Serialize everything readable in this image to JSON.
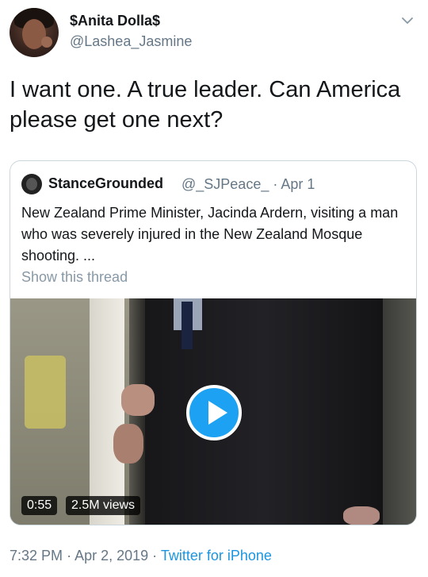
{
  "author": {
    "display_name": "$Anita Dolla$",
    "handle": "@Lashea_Jasmine"
  },
  "tweet": {
    "text": "I want one. A true leader. Can America please get one next?"
  },
  "quoted_tweet": {
    "display_name": "StanceGrounded",
    "handle": "@_SJPeace_",
    "separator": "·",
    "date": "Apr 1",
    "text": "New Zealand Prime Minister, Jacinda Ardern, visiting a man who was severely injured in the New Zealand Mosque shooting. ...",
    "show_thread": "Show this thread",
    "video": {
      "duration": "0:55",
      "views": "2.5M views"
    }
  },
  "footer": {
    "time": "7:32 PM",
    "separator": "·",
    "date": "Apr 2, 2019",
    "source": "Twitter for iPhone"
  },
  "colors": {
    "text_primary": "#14171a",
    "text_secondary": "#657786",
    "link_blue": "#1b95e0",
    "play_blue": "#1da1f2",
    "border": "#ccd6dd"
  },
  "icons": {
    "menu": "chevron-down-icon",
    "play": "play-icon"
  }
}
